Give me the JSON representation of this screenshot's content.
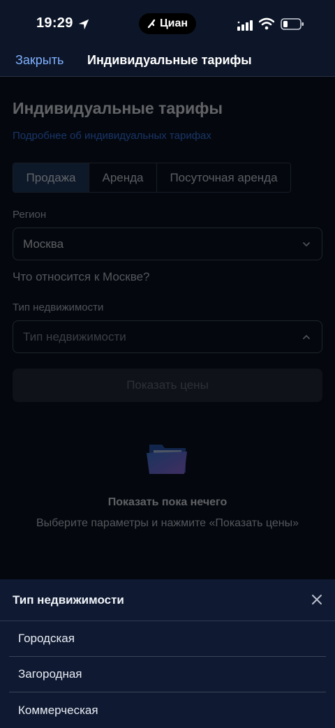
{
  "status": {
    "time": "19:29",
    "app_pill": "Циан"
  },
  "nav": {
    "close": "Закрыть",
    "title": "Индивидуальные тарифы"
  },
  "page": {
    "title": "Индивидуальные тарифы",
    "more_link": "Подробнее об индивидуальных тарифах",
    "tabs": [
      {
        "label": "Продажа",
        "active": true
      },
      {
        "label": "Аренда",
        "active": false
      },
      {
        "label": "Посуточная аренда",
        "active": false
      }
    ],
    "region_label": "Регион",
    "region_value": "Москва",
    "region_link": "Что относится к Москве?",
    "property_label": "Тип недвижимости",
    "property_placeholder": "Тип недвижимости",
    "show_button": "Показать цены",
    "empty_title": "Показать пока нечего",
    "empty_subtitle": "Выберите параметры и нажмите «Показать цены»"
  },
  "sheet": {
    "title": "Тип недвижимости",
    "options": [
      "Городская",
      "Загородная",
      "Коммерческая"
    ]
  },
  "colors": {
    "accent": "#3c7df6",
    "link": "#7fb0ff",
    "background": "#0b1322",
    "sheet": "#0f1a32"
  }
}
